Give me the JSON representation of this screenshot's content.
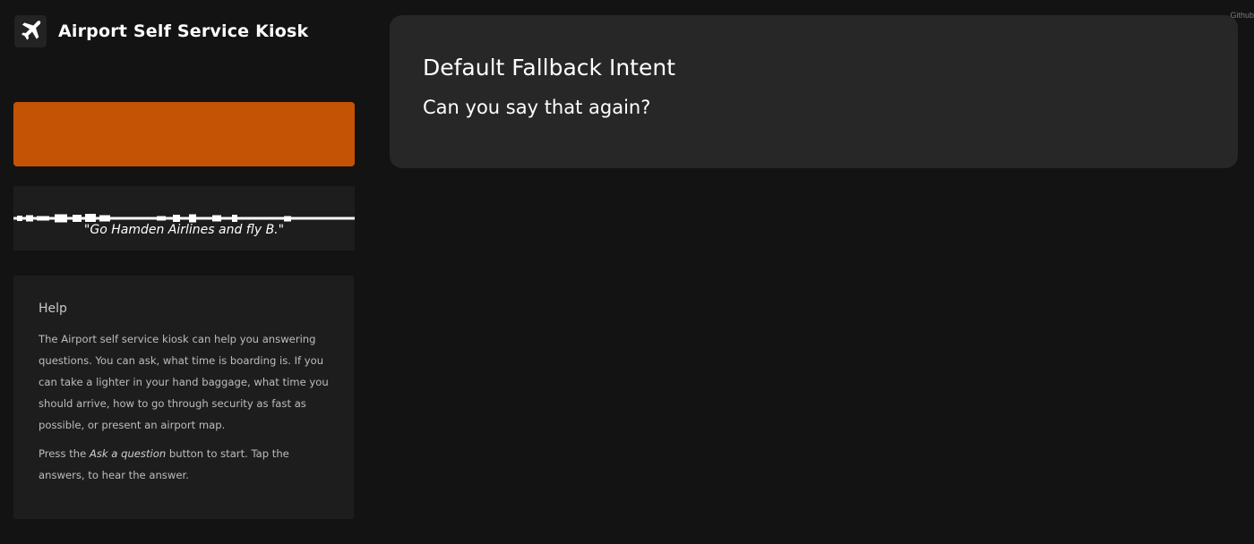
{
  "app": {
    "title": "Airport Self Service Kiosk",
    "logo_icon": "airplane-icon",
    "github_link": "Github"
  },
  "ask_button": {
    "label": "",
    "color": "#c55306"
  },
  "voice": {
    "transcript": "\"Go Hamden Airlines and fly B.\""
  },
  "help": {
    "title": "Help",
    "paragraph1": "The Airport self service kiosk can help you answering questions. You can ask, what time is boarding is. If you can take a lighter in your hand baggage, what time you should arrive, how to go through security as fast as possible, or present an airport map.",
    "paragraph2_before": "Press the ",
    "paragraph2_emphasis": "Ask a question",
    "paragraph2_after": " button to start. Tap the answers, to hear the answer."
  },
  "result": {
    "intent_name": "Default Fallback Intent",
    "response": "Can you say that again?"
  },
  "colors": {
    "background": "#131313",
    "panel": "#1d1d1d",
    "card": "#272727",
    "accent": "#c55306"
  }
}
